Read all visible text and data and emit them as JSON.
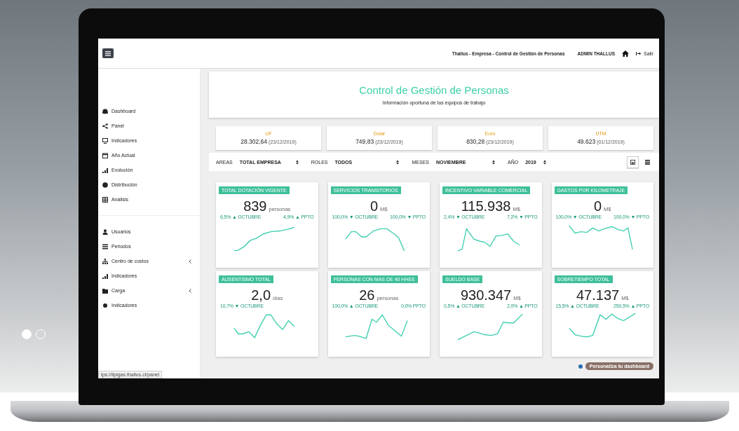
{
  "topbar": {
    "title": "Thallus - Empresa - Control de Gestión de Personas",
    "user": "ADMIN THALLUS",
    "logout": "Salir"
  },
  "sidebar": {
    "groups": [
      [
        {
          "label": "Dashboard",
          "submenu": false
        },
        {
          "label": "Panel",
          "submenu": false
        },
        {
          "label": "Indicadores",
          "submenu": false
        },
        {
          "label": "Año Actual",
          "submenu": false
        },
        {
          "label": "Evolución",
          "submenu": false
        },
        {
          "label": "Distribución",
          "submenu": false
        },
        {
          "label": "Análisis",
          "submenu": false
        }
      ],
      [
        {
          "label": "Usuarios",
          "submenu": false
        },
        {
          "label": "Periodos",
          "submenu": false
        },
        {
          "label": "Centro de costos",
          "submenu": true
        },
        {
          "label": "Indicadores",
          "submenu": false
        },
        {
          "label": "Carga",
          "submenu": true
        },
        {
          "label": "Indicadores",
          "submenu": false
        }
      ]
    ]
  },
  "header": {
    "title": "Control de Gestión de Personas",
    "subtitle": "Información oportuna de tus equipos de trabajo"
  },
  "currencies": [
    {
      "name": "UF",
      "value": "28.302,64",
      "date": "(23/12/2019)"
    },
    {
      "name": "Dolar",
      "value": "749,83",
      "date": "(23/12/2019)"
    },
    {
      "name": "Euro",
      "value": "830,28",
      "date": "(23/12/2019)"
    },
    {
      "name": "UTM",
      "value": "49.623",
      "date": "(01/12/2019)"
    }
  ],
  "filters": [
    {
      "label": "AREAS",
      "value": "TOTAL EMPRESA"
    },
    {
      "label": "ROLES",
      "value": "TODOS"
    },
    {
      "label": "MESES",
      "value": "NOVIEMBRE"
    },
    {
      "label": "AÑO",
      "value": "2019"
    }
  ],
  "views": [
    {
      "kind": "cards",
      "selected": true
    },
    {
      "kind": "table",
      "selected": false
    }
  ],
  "cards": [
    {
      "title": "TOTAL DOTACIÓN VIGENTE",
      "value": "839",
      "unit": "personas",
      "deltas": [
        "6,5% ▲ OCTUBRE",
        "4,9% ▲ PPTO"
      ]
    },
    {
      "title": "SERVICIOS TRANSITORIOS",
      "value": "0",
      "unit": "M$",
      "deltas": [
        "100,0% ▼ OCTUBRE",
        "100,0% ▼ PPTO"
      ]
    },
    {
      "title": "INCENTIVO VARIABLE COMERCIAL",
      "value": "115.938",
      "unit": "M$",
      "deltas": [
        "2,4% ▼ OCTUBRE",
        "7,2% ▼ PPTO"
      ]
    },
    {
      "title": "GASTOS POR KILOMETRAJE",
      "value": "0",
      "unit": "M$",
      "deltas": [
        "100,0% ▼ OCTUBRE",
        "100,0% ▼ PPTO"
      ]
    },
    {
      "title": "AUSENTISMO TOTAL",
      "value": "2,0",
      "unit": "días",
      "deltas": [
        "10,7% ▼ OCTUBRE"
      ]
    },
    {
      "title": "PERSONAS CON MAS DE 40 HHEE",
      "value": "26",
      "unit": "personas",
      "deltas": [
        "100,0% ▲ OCTUBRE",
        "0,0% PPTO"
      ]
    },
    {
      "title": "SUELDO BASE",
      "value": "930.347",
      "unit": "M$",
      "deltas": [
        "0,5% ▲ OCTUBRE",
        "2,0% ▲ PPTO"
      ]
    },
    {
      "title": "SOBRETIEMPO TOTAL",
      "value": "47.137",
      "unit": "M$",
      "deltas": [
        "15,5% ▲ OCTUBRE",
        "250,5% ▲ PPTO"
      ]
    }
  ],
  "customize_button": "Personaliza tu dashboard",
  "status_url": "tps://lipigas.thallus.cl/panel",
  "carousel": [
    {
      "selected": true
    },
    {
      "selected": false
    }
  ]
}
